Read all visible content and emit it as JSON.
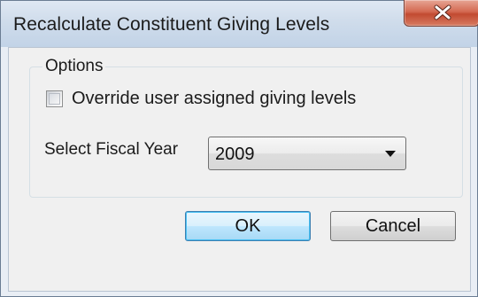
{
  "window": {
    "title": "Recalculate Constituent Giving Levels",
    "close_icon": "close-x-icon"
  },
  "options": {
    "legend": "Options",
    "override_checkbox": {
      "label": "Override user assigned giving levels",
      "checked": false
    },
    "fiscal_year": {
      "label": "Select Fiscal Year",
      "selected": "2009",
      "arrow_icon": "chevron-down-icon"
    }
  },
  "buttons": {
    "ok_label": "OK",
    "cancel_label": "Cancel"
  },
  "colors": {
    "close_button": "#c9553b",
    "default_button_border": "#3c7fb1",
    "dialog_background": "#f0f0f0"
  }
}
